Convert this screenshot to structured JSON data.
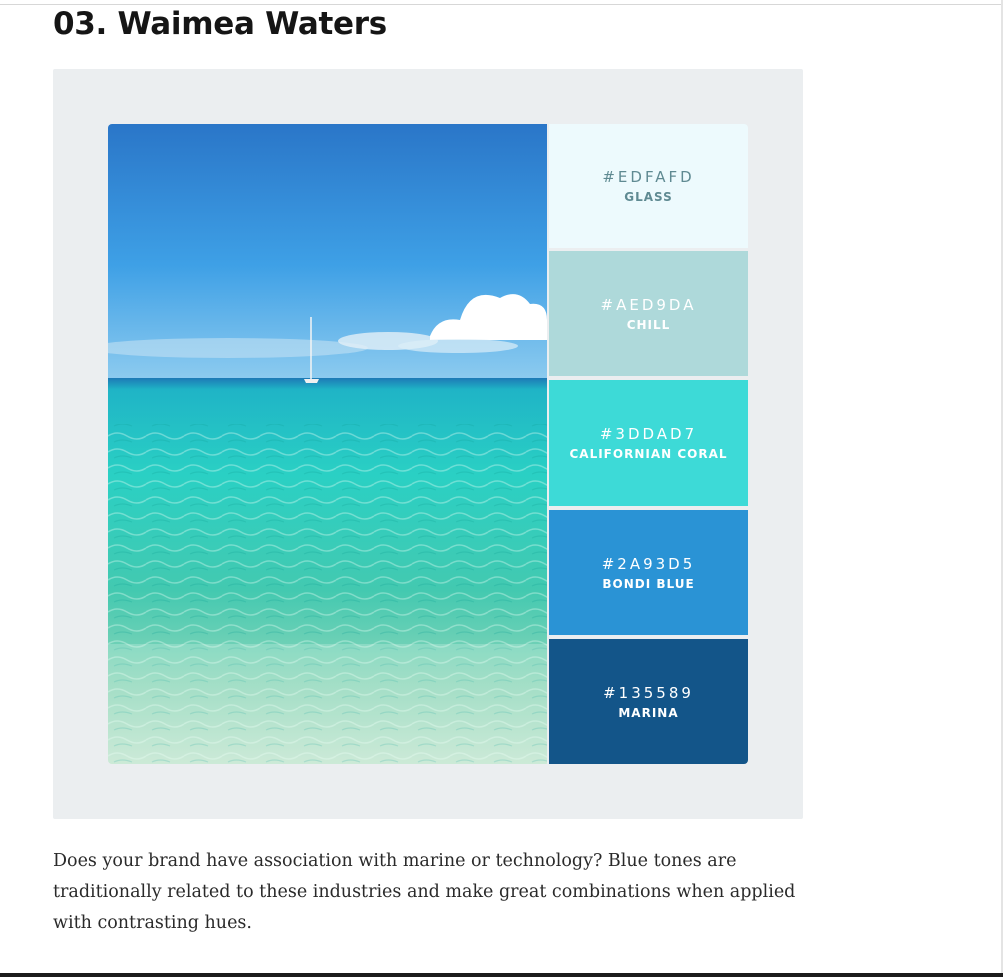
{
  "section": {
    "title": "03. Waimea Waters"
  },
  "palette": {
    "swatches": [
      {
        "hex": "#EDFAFD",
        "name": "GLASS",
        "color": "#edfafd",
        "text_color": "#5f8a92"
      },
      {
        "hex": "#AED9DA",
        "name": "CHILL",
        "color": "#aed9da",
        "text_color": "#ffffff"
      },
      {
        "hex": "#3DDAD7",
        "name": "CALIFORNIAN CORAL",
        "color": "#3ddad7",
        "text_color": "#ffffff"
      },
      {
        "hex": "#2A93D5",
        "name": "BONDI BLUE",
        "color": "#2a93d5",
        "text_color": "#ffffff"
      },
      {
        "hex": "#135589",
        "name": "MARINA",
        "color": "#135589",
        "text_color": "#ffffff"
      }
    ]
  },
  "article": {
    "paragraph": "Does your brand have association with marine or technology? Blue tones are traditionally related to these industries and make great combinations when applied with contrasting hues."
  }
}
